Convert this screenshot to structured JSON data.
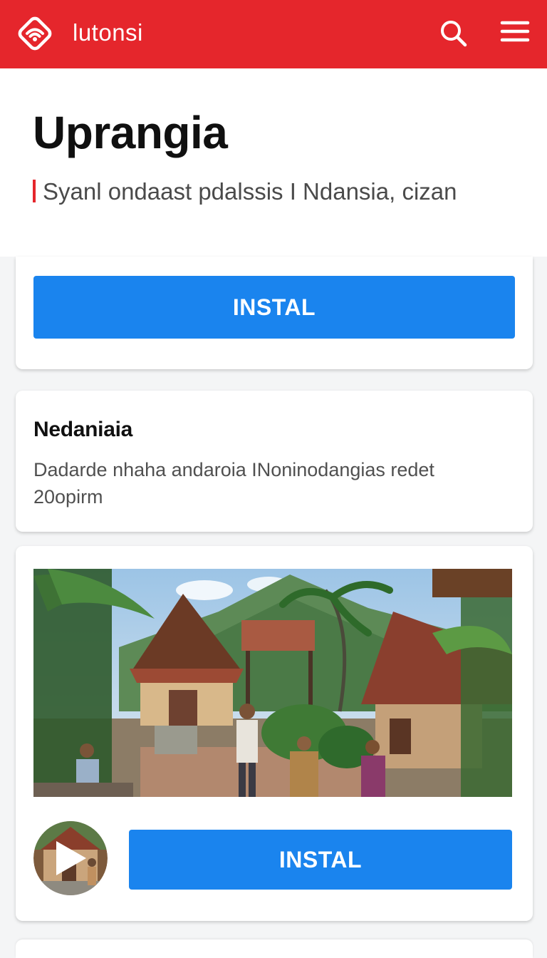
{
  "header": {
    "brand": "lutonsi",
    "logo_icon": "wifi-diamond-icon",
    "search_icon": "search-icon",
    "menu_icon": "hamburger-menu-icon",
    "color": "#e5262c"
  },
  "hero": {
    "title": "Uprangia",
    "subtitle": "Syanl ondaast pdalssis I Ndansia, cizan"
  },
  "card1": {
    "button_label": "INSTAL"
  },
  "card2": {
    "title": "Nedaniaia",
    "body": "Dadarde nhaha andaroia INoninodangias redet 20opirm"
  },
  "card3": {
    "image": "village-photo",
    "play_icon": "play-icon",
    "button_label": "INSTAL"
  },
  "colors": {
    "accent": "#1a84ee",
    "brand": "#e5262c"
  }
}
